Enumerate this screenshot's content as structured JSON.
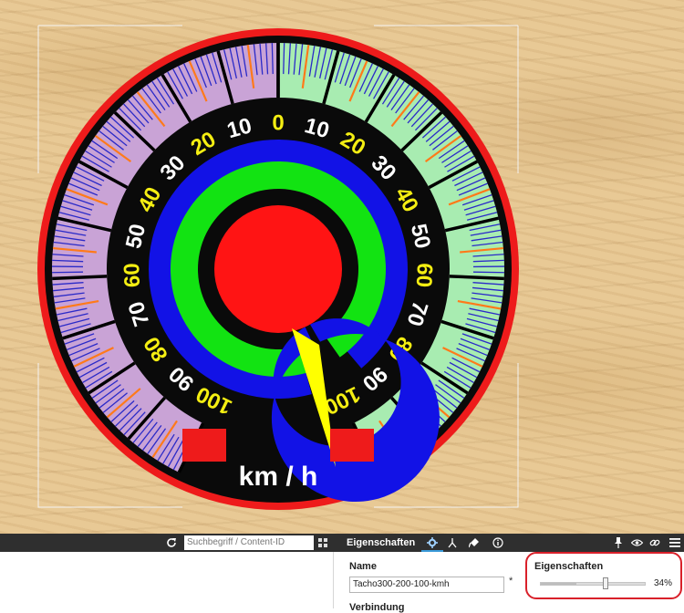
{
  "gauge": {
    "unit_label": "km / h",
    "left_scale": [
      "10",
      "20",
      "30",
      "40",
      "50",
      "60",
      "70",
      "80",
      "90",
      "100"
    ],
    "zero_label": "0",
    "right_scale": [
      "10",
      "20",
      "30",
      "40",
      "50",
      "60",
      "70",
      "80",
      "90",
      "100"
    ],
    "colors": {
      "rim": "#ee1b1b",
      "face": "#0a0a0a",
      "left_band": "#c9a3d6",
      "right_band": "#a8ecb1",
      "label_white": "#ffffff",
      "label_yellow": "#f4ee12",
      "ring_blue": "#1212e6",
      "ring_green": "#12e312",
      "hub": "#ff1414",
      "needle": "#ffff00"
    }
  },
  "toolbar": {
    "refresh_icon": "refresh-icon",
    "search_placeholder": "Suchbegriff / Content-ID",
    "grid_icon": "grid-icon",
    "panel_title": "Eigenschaften",
    "tab_icons": [
      "gear-icon",
      "hierarchy-icon",
      "brush-icon",
      "info-icon"
    ],
    "right_icons": [
      "pin-icon",
      "eye-icon",
      "link-icon",
      "menu-icon"
    ]
  },
  "properties": {
    "name_label": "Name",
    "name_value": "Tacho300-200-100-kmh",
    "required_mark": "*",
    "connection_label": "Verbindung",
    "eigenschaften_label": "Eigenschaften",
    "opacity_percent": 34,
    "opacity_text": "34%"
  }
}
